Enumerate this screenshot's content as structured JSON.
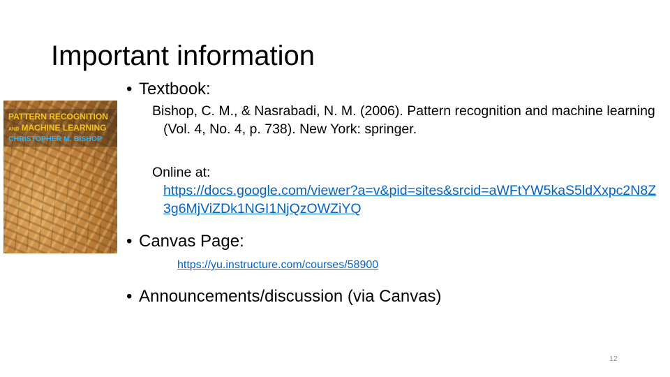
{
  "slide": {
    "title": "Important information",
    "page_number": "12"
  },
  "book_cover": {
    "line1": "PATTERN RECOGNITION",
    "line2_prefix": "AND",
    "line2_main": "MACHINE LEARNING",
    "line3": "CHRISTOPHER M. BISHOP"
  },
  "textbook": {
    "bullet": "•",
    "label": "Textbook:",
    "reference": "Bishop, C. M., & Nasrabadi, N. M. (2006). Pattern recognition and machine learning (Vol. 4, No. 4, p. 738). New York: springer.",
    "online_label": "Online at:",
    "online_url": "https://docs.google.com/viewer?a=v&pid=sites&srcid=aWFtYW5kaS5ldXxpc2N8Z3g6MjViZDk1NGI1NjQzOWZiYQ"
  },
  "canvas": {
    "bullet": "•",
    "label": "Canvas Page:",
    "url": "https://yu.instructure.com/courses/58900"
  },
  "announcements": {
    "bullet": "•",
    "label": "Announcements/discussion (via Canvas)"
  },
  "colors": {
    "link": "#0563c1",
    "cover_title": "#f5c518",
    "cover_author": "#3db0e8"
  }
}
